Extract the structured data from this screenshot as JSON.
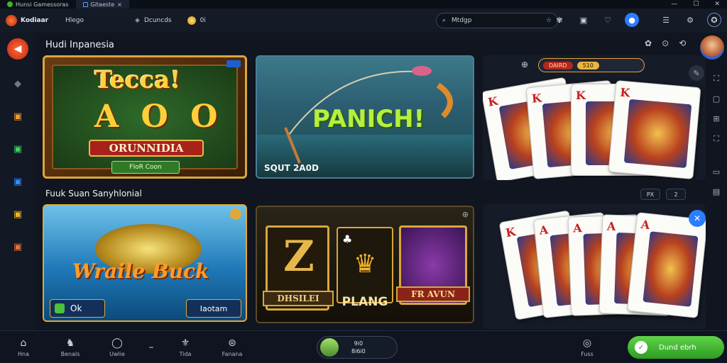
{
  "window": {
    "tab1_label": "Hunsi Gamessoras",
    "tab2_label": "Gitaeste",
    "close_glyph": "×",
    "minimize_glyph": "—",
    "maximize_glyph": "☐",
    "winclose_glyph": "✕"
  },
  "topbar": {
    "brand": "Kodiaar",
    "nav_item": "Hlego",
    "balance_label": "Dcuncds",
    "coin_value": "0i",
    "search_text": "Mtdgp"
  },
  "sections": {
    "featured_title": "Hudi Inpanesia",
    "second_title": "Fuuk Suan Sanyhlonial"
  },
  "games": {
    "treasure": {
      "title": "Tecca!",
      "letters": "A O O",
      "subtitle": "ORUNNIDIA",
      "button": "FIoR Coon"
    },
    "fishing": {
      "title": "PANICH!",
      "caption": "SQUT 2A0D"
    },
    "cards_top": {
      "badge": "DAIRD",
      "badge_value": "510"
    },
    "fish_slot": {
      "title": "Wraile Buck",
      "left_btn": "Ok",
      "right_btn": "Iaotam"
    },
    "slot_panels": {
      "left": "DHSILEI",
      "center": "PLANG",
      "right": "FR AVUN",
      "big_letter": "Z"
    },
    "cards_bottom": {
      "chip1": "PX",
      "chip2": "2"
    }
  },
  "cards_top": [
    "K",
    "K",
    "K",
    "K"
  ],
  "cards_bottom": [
    "K",
    "A",
    "A",
    "A",
    "A"
  ],
  "bottom_nav": {
    "home": "Hna",
    "games": "Benals",
    "chat": "Uwlie",
    "tabs": "Tida",
    "promo": "Fanana"
  },
  "wallet": {
    "line1": "9i0",
    "line2": "8i6i0"
  },
  "support_label": "Fuss",
  "deposit_label": "Dund ebrh",
  "colors": {
    "accent": "#2b7dff",
    "brand": "#e0441b",
    "deposit": "#3db52b",
    "gold": "#f2c14e"
  },
  "icons": {
    "home": "home-icon",
    "search": "search-icon",
    "star": "star-icon",
    "bell": "bell-icon",
    "settings": "settings-icon"
  }
}
